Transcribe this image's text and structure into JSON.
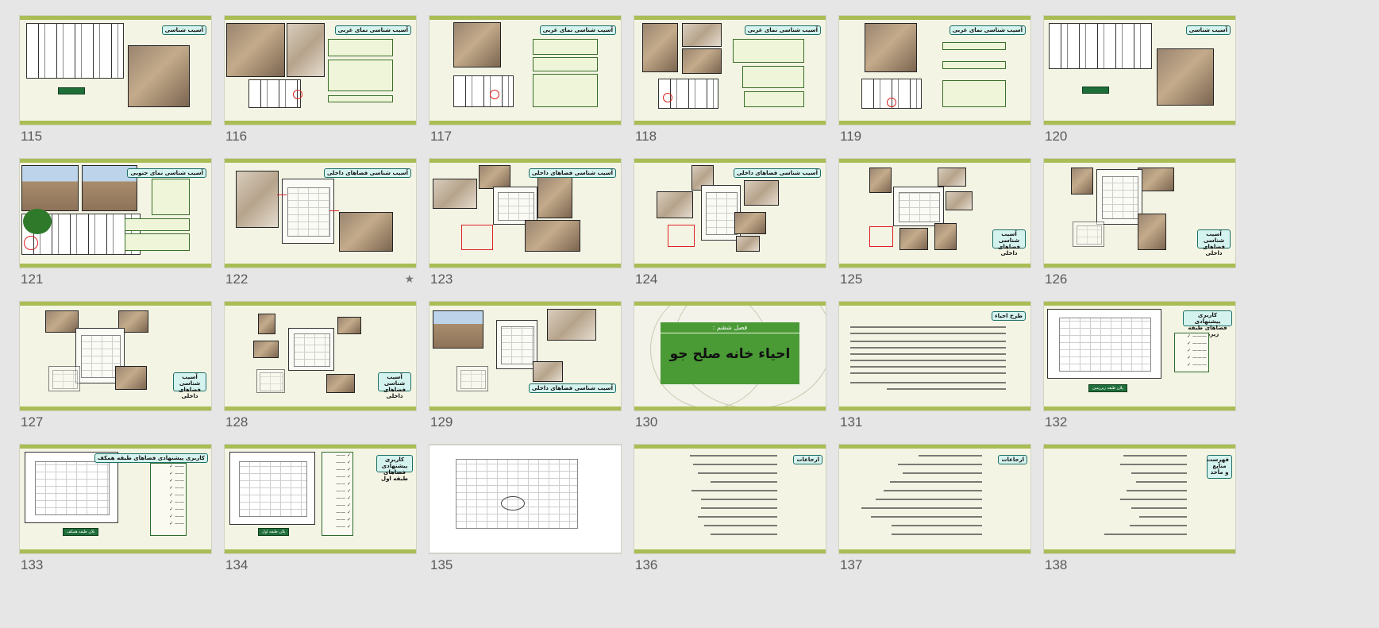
{
  "slides": [
    {
      "number": "115",
      "badge": "آسیب شناسی"
    },
    {
      "number": "116",
      "badge": "آسیب شناسی نمای غربی"
    },
    {
      "number": "117",
      "badge": "آسیب شناسی نمای غربی"
    },
    {
      "number": "118",
      "badge": "آسیب شناسی نمای غربی"
    },
    {
      "number": "119",
      "badge": "آسیب شناسی نمای غربی"
    },
    {
      "number": "120",
      "badge": "آسیب شناسی"
    },
    {
      "number": "121",
      "badge": "آسیب شناسی نمای جنوبی"
    },
    {
      "number": "122",
      "badge": "آسیب شناسی فضاهای داخلی",
      "starred": true
    },
    {
      "number": "123",
      "badge": "آسیب شناسی فضاهای داخلی"
    },
    {
      "number": "124",
      "badge": "آسیب شناسی فضاهای داخلی"
    },
    {
      "number": "125",
      "badge": "آسیب شناسی فضاهای داخلی"
    },
    {
      "number": "126",
      "badge": "آسیب شناسی فضاهای داخلی"
    },
    {
      "number": "127",
      "badge": "آسیب شناسی فضاهای داخلی"
    },
    {
      "number": "128",
      "badge": "آسیب شناسی فضاهای داخلی"
    },
    {
      "number": "129",
      "badge": "آسیب شناسی فضاهای داخلی"
    },
    {
      "number": "130",
      "subtitle": "فصل ششم :",
      "title": "احیاء خانه صلح جو"
    },
    {
      "number": "131",
      "badge": "طرح احیاء"
    },
    {
      "number": "132",
      "badge": "کاربری پیشنهادی فضاهای طبقه زیرزمین",
      "caption": "پلان طبقه زیرزمین"
    },
    {
      "number": "133",
      "badge": "کاربری پیشنهادی فضاهای طبقه همکف",
      "caption": "پلان طبقه همکف"
    },
    {
      "number": "134",
      "badge": "کاربری پیشنهادی فضاهای طبقه اول",
      "caption": "پلان طبقه اول"
    },
    {
      "number": "135"
    },
    {
      "number": "136",
      "badge": "ارجاعات"
    },
    {
      "number": "137",
      "badge": "ارجاعات"
    },
    {
      "number": "138",
      "badge": "فهرست منابع و مآخذ"
    }
  ],
  "icons": {
    "starred": "star-icon"
  },
  "colors": {
    "accent": "#a9bd55",
    "title_green": "#4a9a36",
    "badge_fill": "#d4f2ee"
  }
}
